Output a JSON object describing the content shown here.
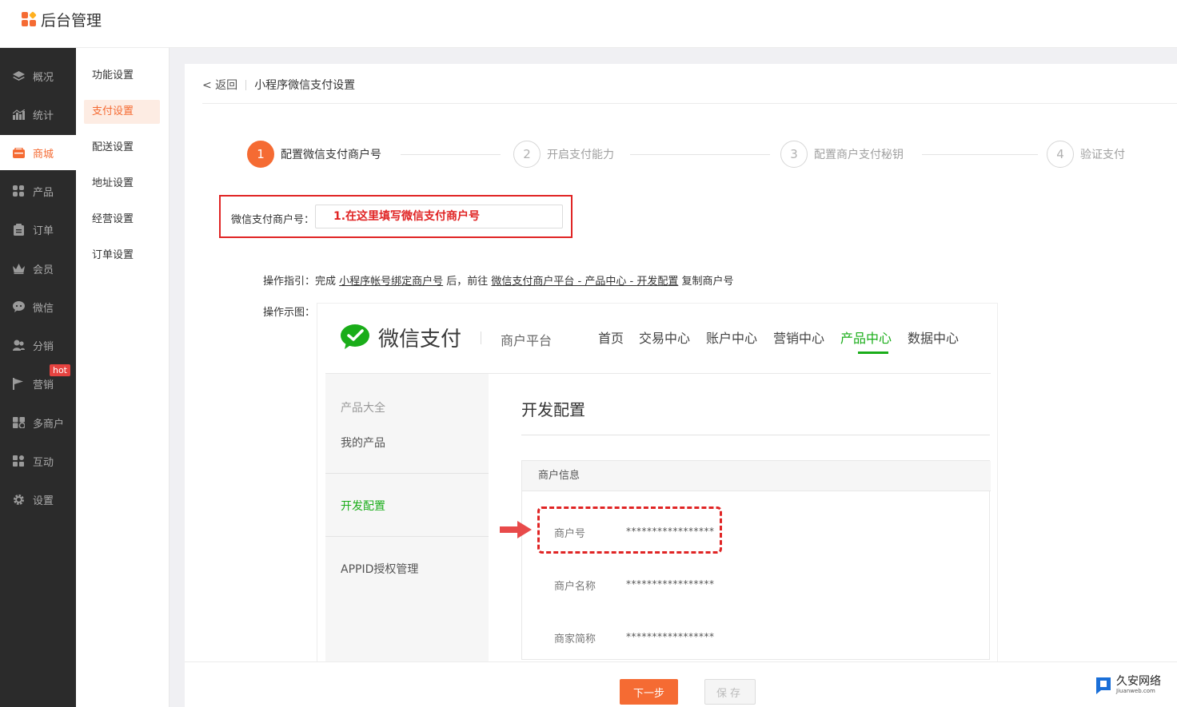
{
  "app": {
    "title": "后台管理"
  },
  "sidebar": {
    "items": [
      {
        "label": "概况",
        "icon": "layers-icon"
      },
      {
        "label": "统计",
        "icon": "chart-icon"
      },
      {
        "label": "商城",
        "icon": "store-icon",
        "active": true
      },
      {
        "label": "产品",
        "icon": "grid-icon"
      },
      {
        "label": "订单",
        "icon": "clipboard-icon"
      },
      {
        "label": "会员",
        "icon": "crown-icon"
      },
      {
        "label": "微信",
        "icon": "chat-icon"
      },
      {
        "label": "分销",
        "icon": "users-icon"
      },
      {
        "label": "营销",
        "icon": "flag-icon",
        "badge": "hot"
      },
      {
        "label": "多商户",
        "icon": "shop-icon"
      },
      {
        "label": "互动",
        "icon": "apps-icon"
      },
      {
        "label": "设置",
        "icon": "gear-icon"
      }
    ]
  },
  "submenu": {
    "items": [
      {
        "label": "功能设置"
      },
      {
        "label": "支付设置",
        "active": true
      },
      {
        "label": "配送设置"
      },
      {
        "label": "地址设置"
      },
      {
        "label": "经营设置"
      },
      {
        "label": "订单设置"
      }
    ]
  },
  "breadcrumb": {
    "back": "< 返回",
    "title": "小程序微信支付设置"
  },
  "steps": [
    {
      "num": "1",
      "label": "配置微信支付商户号",
      "active": true
    },
    {
      "num": "2",
      "label": "开启支付能力"
    },
    {
      "num": "3",
      "label": "配置商户支付秘钥"
    },
    {
      "num": "4",
      "label": "验证支付"
    }
  ],
  "form": {
    "merchant_label": "微信支付商户号：",
    "merchant_placeholder": "1.在这里填写微信支付商户号"
  },
  "guide": {
    "prefix": "操作指引：完成 ",
    "link1": "小程序帐号绑定商户号",
    "middle": " 后，前往 ",
    "link2": "微信支付商户平台 - 产品中心 - 开发配置",
    "suffix": " 复制商户号"
  },
  "demo": {
    "label": "操作示图：",
    "brand": "微信支付",
    "platform": "商户平台",
    "nav": [
      "首页",
      "交易中心",
      "账户中心",
      "营销中心",
      "产品中心",
      "数据中心"
    ],
    "nav_active": "产品中心",
    "side": [
      "产品大全",
      "我的产品",
      "开发配置",
      "APPID授权管理"
    ],
    "section_title": "开发配置",
    "info_title": "商户信息",
    "rows": [
      {
        "label": "商户号",
        "value": "*****************"
      },
      {
        "label": "商户名称",
        "value": "*****************"
      },
      {
        "label": "商家简称",
        "value": "*****************"
      }
    ]
  },
  "buttons": {
    "next": "下一步",
    "save": "保存"
  },
  "watermark": {
    "title": "久安网络",
    "sub": "Jiuanweb.com"
  },
  "colors": {
    "accent": "#f56b33",
    "wechat_green": "#1aad19",
    "highlight_red": "#e02424",
    "sidebar_bg": "#2b2b2b"
  }
}
